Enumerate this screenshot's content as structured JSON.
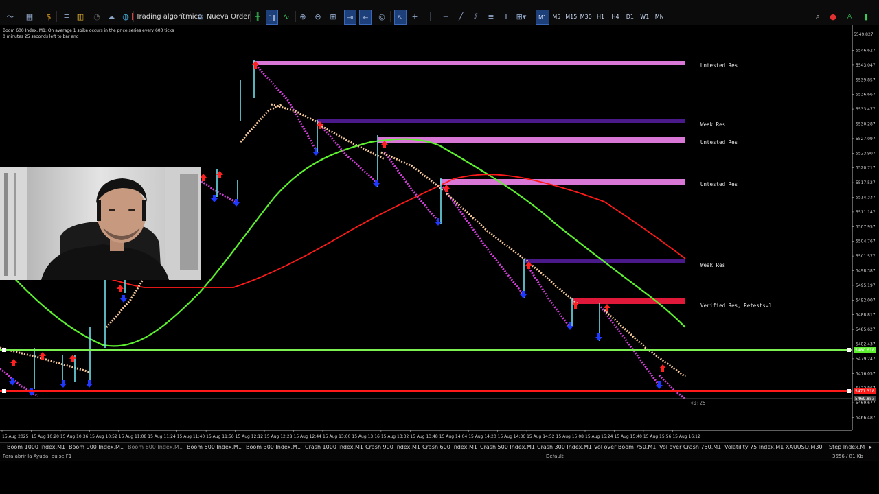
{
  "toolbar": {
    "algo_label": "Trading algorítmico",
    "new_order_label": "Nueva Orden",
    "timeframes": [
      "M1",
      "M5",
      "M15",
      "M30",
      "H1",
      "H4",
      "D1",
      "W1",
      "MN"
    ],
    "active_timeframe": "M1"
  },
  "chart": {
    "header_line1": "Boom 600 Index, M1:  On average 1 spike occurs in the price series every 600 ticks",
    "header_line2": "0 minutes 25 seconds left to bar end",
    "price_ticks": [
      "5546.627",
      "5543.047",
      "5539.857",
      "5536.667",
      "5533.477",
      "5530.287",
      "5527.097",
      "5523.907",
      "5520.717",
      "5517.527",
      "5514.337",
      "5511.147",
      "5507.957",
      "5504.767",
      "5501.577",
      "5498.387",
      "5495.197",
      "5492.007",
      "5488.817",
      "5485.627",
      "5482.437",
      "5479.247",
      "5476.057",
      "5472.867",
      "5469.677",
      "5466.487"
    ],
    "price_top_label": "5549.827",
    "current_price_label": "5469.853",
    "green_line_label": "5480.618",
    "red_line_label": "5471.318",
    "time_ticks": [
      "15 Aug 2025",
      "15 Aug 10:20",
      "15 Aug 10:36",
      "15 Aug 10:52",
      "15 Aug 11:08",
      "15 Aug 11:24",
      "15 Aug 11:40",
      "15 Aug 11:56",
      "15 Aug 12:12",
      "15 Aug 12:28",
      "15 Aug 12:44",
      "15 Aug 13:00",
      "15 Aug 13:16",
      "15 Aug 13:32",
      "15 Aug 13:48",
      "15 Aug 14:04",
      "15 Aug 14:20",
      "15 Aug 14:36",
      "15 Aug 14:52",
      "15 Aug 15:08",
      "15 Aug 15:24",
      "15 Aug 15:40",
      "15 Aug 15:56",
      "15 Aug 16:12"
    ],
    "countdown": "<0:25",
    "zones": [
      {
        "label": "Untested Res",
        "color": "#d877d6"
      },
      {
        "label": "Weak Res",
        "color": "#4b1a8a"
      },
      {
        "label": "Untested Res",
        "color": "#d877d6"
      },
      {
        "label": "Untested Res",
        "color": "#d877d6"
      },
      {
        "label": "Weak Res",
        "color": "#4b1a8a"
      },
      {
        "label": "Verified Res, Retests=1",
        "color": "#e0183a"
      }
    ],
    "colors": {
      "fast_ma": "#5cf02f",
      "slow_ma": "#ff1a1a",
      "support_line": "#7cf252",
      "red_line": "#ff1a1a",
      "trail_down": "#d040d8",
      "trail_up": "#f4c89a",
      "spike": "#6fe0ec"
    }
  },
  "tabs": [
    "Boom 1000 Index,M1",
    "Boom 900 Index,M1",
    "Boom 600 Index,M1",
    "Boom 500 Index,M1",
    "Boom 300 Index,M1",
    "Crash 1000 Index,M1",
    "Crash 900 Index,M1",
    "Crash 600 Index,M1",
    "Crash 500 Index,M1",
    "Crash 300 Index,M1",
    "Vol over Boom 750,M1",
    "Vol over Crash 750,M1",
    "Volatility 75 Index,M1",
    "XAUUSD,M30",
    "Step Index,M"
  ],
  "active_tab": "Boom 600 Index,M1",
  "status": {
    "help": "Para abrir la Ayuda, pulse F1",
    "profile": "Default",
    "traffic": "3556 / 81 Kb"
  }
}
